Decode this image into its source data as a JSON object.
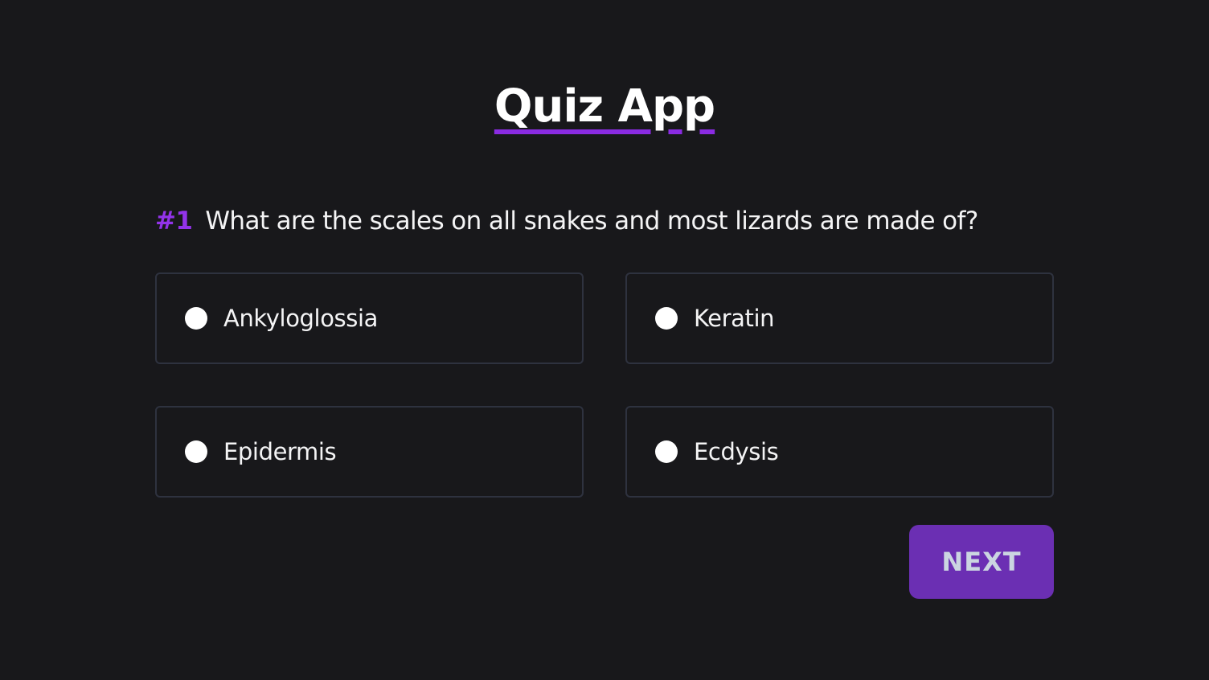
{
  "app": {
    "title": "Quiz App"
  },
  "question": {
    "number": "#1",
    "text": "What are the scales on all snakes and most lizards are made of?"
  },
  "options": [
    {
      "label": "Ankyloglossia",
      "selected": false
    },
    {
      "label": "Keratin",
      "selected": false
    },
    {
      "label": "Epidermis",
      "selected": false
    },
    {
      "label": "Ecdysis",
      "selected": false
    }
  ],
  "actions": {
    "next_label": "NEXT"
  },
  "colors": {
    "background": "#18181b",
    "accent": "#8a2be2",
    "button": "#6b2fb3",
    "option_border": "#2e323f"
  }
}
